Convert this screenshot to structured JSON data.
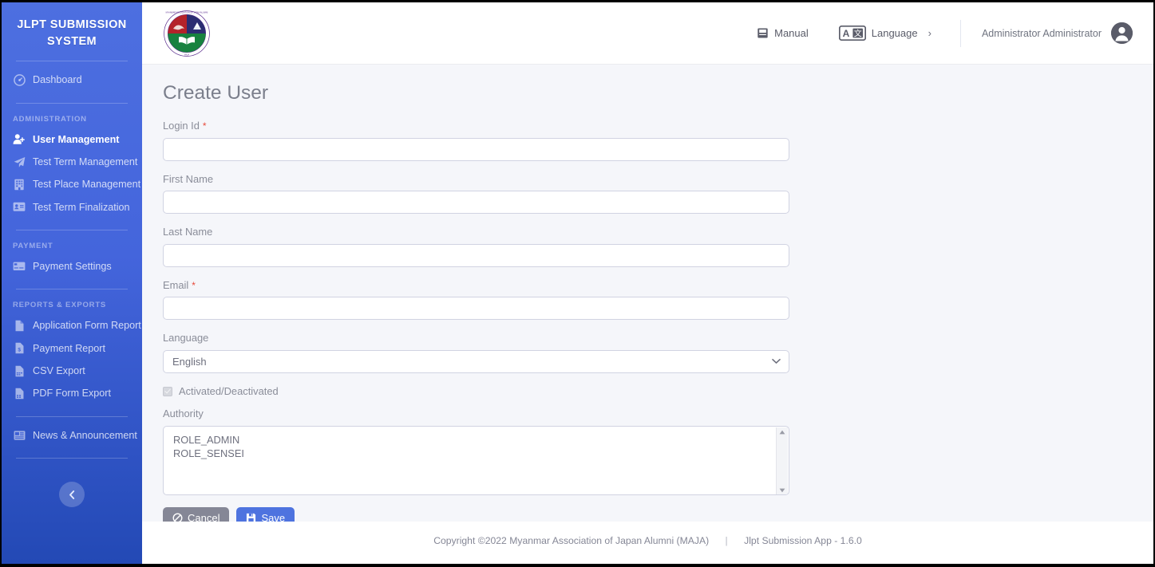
{
  "sidebar": {
    "brand": "JLPT SUBMISSION SYSTEM",
    "dashboard": {
      "label": "Dashboard",
      "icon": "tachometer-icon"
    },
    "sections": [
      {
        "heading": "ADMINISTRATION",
        "items": [
          {
            "label": "User Management",
            "icon": "user-plus-icon",
            "active": true
          },
          {
            "label": "Test Term Management",
            "icon": "paper-plane-icon",
            "active": false
          },
          {
            "label": "Test Place Management",
            "icon": "building-icon",
            "active": false
          },
          {
            "label": "Test Term Finalization",
            "icon": "id-card-icon",
            "active": false
          }
        ]
      },
      {
        "heading": "PAYMENT",
        "items": [
          {
            "label": "Payment Settings",
            "icon": "credit-card-icon",
            "active": false
          }
        ]
      },
      {
        "heading": "REPORTS & EXPORTS",
        "items": [
          {
            "label": "Application Form Report",
            "icon": "file-icon",
            "active": false
          },
          {
            "label": "Payment Report",
            "icon": "file-invoice-dollar-icon",
            "active": false
          },
          {
            "label": "CSV Export",
            "icon": "file-csv-icon",
            "active": false
          },
          {
            "label": "PDF Form Export",
            "icon": "file-pdf-icon",
            "active": false
          }
        ]
      },
      {
        "heading": "",
        "items": [
          {
            "label": "News & Announcement",
            "icon": "newspaper-icon",
            "active": false
          }
        ]
      }
    ],
    "collapse_icon": "chevron-left-icon",
    "bg_color": "#4465dc"
  },
  "topbar": {
    "logo": {
      "name": "maja-logo",
      "alt": "Myanmar Association of Japan Alumni emblem"
    },
    "manual": {
      "label": "Manual",
      "icon": "book-icon"
    },
    "language": {
      "label": "Language",
      "icon": "translate-icon",
      "chevron": "›"
    },
    "user": {
      "name": "Administrator Administrator",
      "avatar_icon": "user-circle-icon"
    }
  },
  "page": {
    "title": "Create User"
  },
  "form": {
    "login_id": {
      "label": "Login Id",
      "required": true,
      "value": "",
      "placeholder": ""
    },
    "first_name": {
      "label": "First Name",
      "required": false,
      "value": "",
      "placeholder": ""
    },
    "last_name": {
      "label": "Last Name",
      "required": false,
      "value": "",
      "placeholder": ""
    },
    "email": {
      "label": "Email",
      "required": true,
      "value": "",
      "placeholder": ""
    },
    "language": {
      "label": "Language",
      "selected": "English",
      "options": [
        "English"
      ]
    },
    "activated": {
      "label": "Activated/Deactivated",
      "checked": true,
      "disabled": true
    },
    "authority": {
      "label": "Authority",
      "options": [
        "ROLE_ADMIN",
        "ROLE_SENSEI"
      ]
    },
    "required_marker": "*",
    "buttons": {
      "cancel": {
        "label": "Cancel",
        "icon": "ban-icon",
        "color": "#858796"
      },
      "save": {
        "label": "Save",
        "icon": "save-icon",
        "color": "#4e73df"
      }
    }
  },
  "footer": {
    "copyright": "Copyright ©2022 Myanmar Association of Japan Alumni (MAJA)",
    "separator": "|",
    "app_version": "Jlpt Submission App - 1.6.0"
  }
}
